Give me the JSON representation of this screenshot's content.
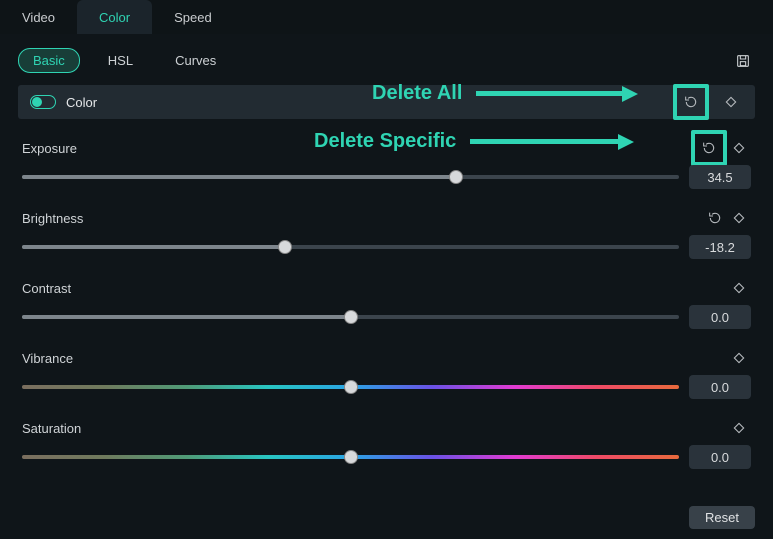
{
  "tabs": {
    "video": "Video",
    "color": "Color",
    "speed": "Speed"
  },
  "subtabs": {
    "basic": "Basic",
    "hsl": "HSL",
    "curves": "Curves"
  },
  "section": {
    "title": "Color"
  },
  "props": {
    "exposure": {
      "label": "Exposure",
      "value": "34.5",
      "pos": 66,
      "has_reset": true,
      "highlight": true,
      "rainbow": false,
      "filled": true
    },
    "brightness": {
      "label": "Brightness",
      "value": "-18.2",
      "pos": 40,
      "has_reset": true,
      "highlight": false,
      "rainbow": false,
      "filled": true
    },
    "contrast": {
      "label": "Contrast",
      "value": "0.0",
      "pos": 50,
      "has_reset": false,
      "highlight": false,
      "rainbow": false,
      "filled": true
    },
    "vibrance": {
      "label": "Vibrance",
      "value": "0.0",
      "pos": 50,
      "has_reset": false,
      "highlight": false,
      "rainbow": true,
      "filled": false
    },
    "saturation": {
      "label": "Saturation",
      "value": "0.0",
      "pos": 50,
      "has_reset": false,
      "highlight": false,
      "rainbow": true,
      "filled": false
    }
  },
  "annotations": {
    "delete_all": "Delete All",
    "delete_specific": "Delete Specific"
  },
  "footer": {
    "reset": "Reset"
  }
}
